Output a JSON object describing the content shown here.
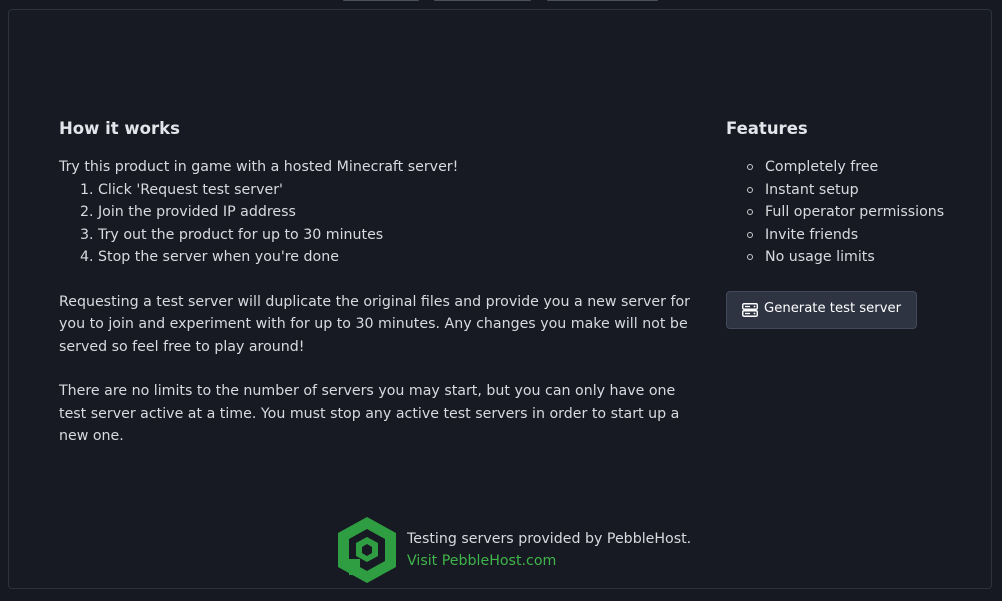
{
  "how_it_works": {
    "heading": "How it works",
    "intro": "Try this product in game with a hosted Minecraft server!",
    "steps": [
      "Click 'Request test server'",
      "Join the provided IP address",
      "Try out the product for up to 30 minutes",
      "Stop the server when you're done"
    ],
    "paragraph1": "Requesting a test server will duplicate the original files and provide you a new server for you to join and experiment with for up to 30 minutes. Any changes you make will not be served so feel free to play around!",
    "paragraph2": "There are no limits to the number of servers you may start, but you can only have one test server active at a time. You must stop any active test servers in order to start up a new one."
  },
  "features": {
    "heading": "Features",
    "items": [
      "Completely free",
      "Instant setup",
      "Full operator permissions",
      "Invite friends",
      "No usage limits"
    ],
    "button_label": "Generate test server",
    "button_icon": "server-icon"
  },
  "footer": {
    "provider_text": "Testing servers provided by PebbleHost.",
    "link_text": "Visit PebbleHost.com",
    "logo_icon": "pebblehost-logo-icon"
  },
  "colors": {
    "background": "#161922",
    "panel_border": "#2e323d",
    "button_bg": "#2f3442",
    "link_green": "#3fb44a",
    "logo_green": "#2f9e43"
  }
}
